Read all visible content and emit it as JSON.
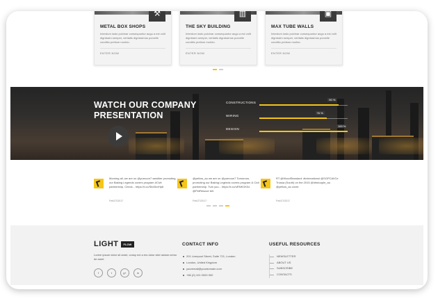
{
  "services": [
    {
      "title": "METAL BOX SHOPS",
      "desc": "Interdum iusto pulvinar consequuntur augu a est volit dignissim semper, veritatis dignissimos porcelle conditio pretium morbio.",
      "link": "ENTER NOW",
      "icon": "tools-icon"
    },
    {
      "title": "THE SKY BUILDING",
      "desc": "Interdum iusto pulvinar consequuntur augu a est volit dignissim semper, veritatis dignissimos porcelle conditio pretium morbio.",
      "link": "ENTER NOW",
      "icon": "building-icon"
    },
    {
      "title": "MAX TUBE WALLS",
      "desc": "Interdum iusto pulvinar consequuntur augu a est volit dignissim semper, veritatis dignissimos porcelle conditio pretium morbio.",
      "link": "ENTER NOW",
      "icon": "toolbox-icon"
    }
  ],
  "presentation": {
    "heading": "WATCH OUR COMPANY PRESENTATION",
    "skills": [
      {
        "label": "CONSTRUCTIONS",
        "value": 90,
        "pct": "90 %"
      },
      {
        "label": "WIRING",
        "value": 76,
        "pct": "76 %"
      },
      {
        "label": "DESIGN",
        "value": 100,
        "pct": "100 %"
      }
    ]
  },
  "tweets": [
    {
      "text": "Morning all, we are on @yurnoon7 weather promoting our Baking Legends covers program #Civil partnership. Check... https://t.co/Sbd3vvHp6",
      "date": "Feb/27/2017"
    },
    {
      "text": "@yellow_au we are on @yurnoon7 Tomorrow, promoting our Baking Legends covers program & Civil partnership. Tum you... https://t.co/uRNKGK0z @PetRescue tell.",
      "date": "Feb/27/2017"
    },
    {
      "text": "RT @WoodStandard: #internationsl @SGPCAVCe Trussa (South) on the 2015 @Infotouple_au @yellow_au cover.",
      "date": "Feb/27/2017"
    }
  ],
  "footer": {
    "logo_word": "LIGHT",
    "logo_tag": "FLOW",
    "about": "Lorem ipsum dolor sit amet, consy ect a ers dolor stict radam nemo de amet",
    "social": [
      "f",
      "t",
      "g+",
      "in"
    ],
    "contact_title": "CONTACT INFO",
    "contact": [
      "201 Liverpool Street, Suite 721, London",
      "London, United Kingdom",
      "youremail@yourdomain.com",
      "+66 (0) 101 0000 000"
    ],
    "resources_title": "USEFUL RESOURCES",
    "resources": [
      "NEWSLETTER",
      "ABOUT US",
      "SUBSCRIBE",
      "CONTACTS"
    ]
  },
  "colors": {
    "accent": "#f5c518",
    "dark": "#222222"
  }
}
